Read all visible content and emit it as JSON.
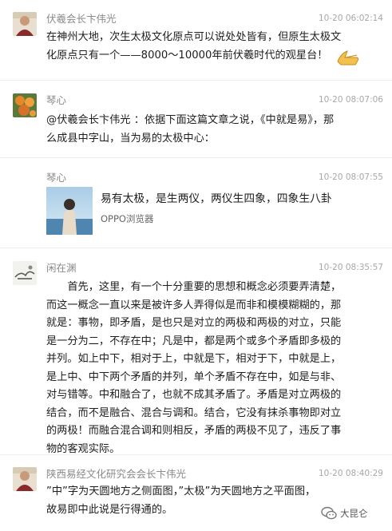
{
  "comments": [
    {
      "author": "伏羲会长卞伟光",
      "time": "10-20 06:02:14",
      "lines": [
        "在神州大地，次生太极文化原点可以说处处皆有，但原生太极文",
        "化原点只有一个——8000～10000年前伏羲时代的观星台！"
      ],
      "emoji": "thumbs-up-emoji"
    },
    {
      "author": "琴心",
      "time": "10-20 08:07:06",
      "lines": [
        "@伏羲会长卞伟光 ：依据下面这篇文章之说，《中就是易》，那",
        "么成县中字山，当为易的太极中心："
      ]
    },
    {
      "author": "琴心",
      "time": "10-20 08:07:55",
      "card": {
        "title": "易有太极，是生两仪，两仪生四象，四象生八卦",
        "source": "OPPO浏览器"
      }
    },
    {
      "author": "闲在渊",
      "time": "10-20 08:35:57",
      "lines": [
        "　　首先，这里，有一个十分重要的思想和概念必须要弄清楚，",
        "而这一概念一直以来是被许多人弄得似是而非和模模糊糊的，那",
        "就是：事物，即矛盾，是也只是对立的两极和两极的对立，只能",
        "是一分为二，不存在中；凡是中，都是两个或多个矛盾即多极的",
        "并列。如上中下，相对于上，中就是下，相对于下，中就是上，",
        "是上中、中下两个矛盾的并列，单个矛盾不存在中，如是与非、",
        "对与错等。中和融合了，也就不成其矛盾了。矛盾是对立两极的",
        "结合，而不是融合、混合与调和。结合，它没有抹杀事物即对立",
        "的两极！而融合混合调和则相反，矛盾的两极不见了，违反了事",
        "物的客观实际。"
      ]
    },
    {
      "author": "陕西易经文化研究会会长卞伟光",
      "time": "10-20 08:40:29",
      "lines": [
        "”中”字为天圆地方之侧面图，”太极”为天圆地方之平面图，",
        "故易即中此说是行得通的。"
      ]
    }
  ],
  "watermark": {
    "icon": "wechat-official-account-icon",
    "text": "大昆仑"
  },
  "colors": {
    "name": "#8a8a8a",
    "time": "#a8a8a8",
    "body": "#1e1e1e",
    "separator": "#ececec"
  }
}
